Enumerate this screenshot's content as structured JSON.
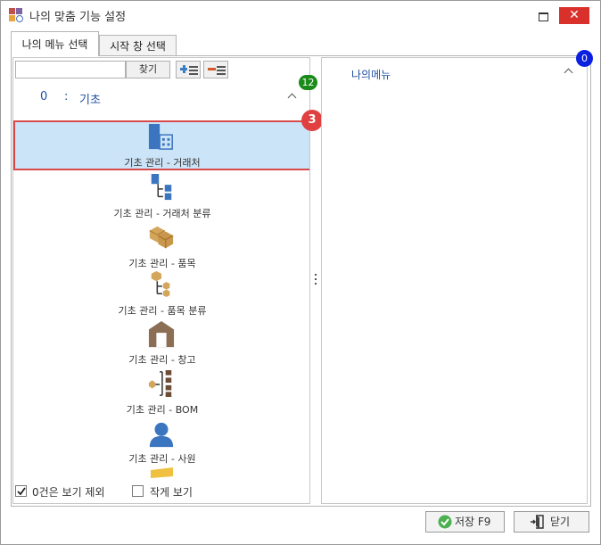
{
  "window": {
    "title": "나의 맞춤 기능 설정",
    "close_glyph": "✕"
  },
  "tabs": [
    {
      "label": "나의 메뉴 선택",
      "active": true
    },
    {
      "label": "시작 창 선택",
      "active": false
    }
  ],
  "left_panel": {
    "search": {
      "value": "",
      "placeholder": ""
    },
    "search_button": "찾기",
    "group": {
      "number": "0",
      "separator": ":",
      "name": "기초"
    },
    "group_badge": "12",
    "selected_badge": "3",
    "items": [
      {
        "label": "기초 관리 - 거래처",
        "icon": "building-icon"
      },
      {
        "label": "기초 관리 - 거래처 분류",
        "icon": "org-tree-icon"
      },
      {
        "label": "기초 관리 - 품목",
        "icon": "boxes-icon"
      },
      {
        "label": "기초 관리 - 품목 분류",
        "icon": "box-tree-icon"
      },
      {
        "label": "기초 관리 - 창고",
        "icon": "warehouse-icon"
      },
      {
        "label": "기초 관리 - BOM",
        "icon": "bom-tree-icon"
      },
      {
        "label": "기초 관리 - 사원",
        "icon": "person-icon"
      }
    ],
    "options": [
      {
        "label": "0건은 보기 제외",
        "checked": true
      },
      {
        "label": "작게 보기",
        "checked": false
      }
    ]
  },
  "right_panel": {
    "title": "나의메뉴",
    "badge": "0"
  },
  "footer": {
    "save_label": "저장 F9",
    "close_label": "닫기"
  },
  "colors": {
    "selected_bg": "#cce4f7",
    "selected_border": "#d84a4a",
    "badge_green": "#1a8a1a",
    "badge_blue": "#0a1fe0",
    "badge_red": "#e04040",
    "link_blue": "#1f4fa0",
    "close_red": "#d9302c"
  }
}
